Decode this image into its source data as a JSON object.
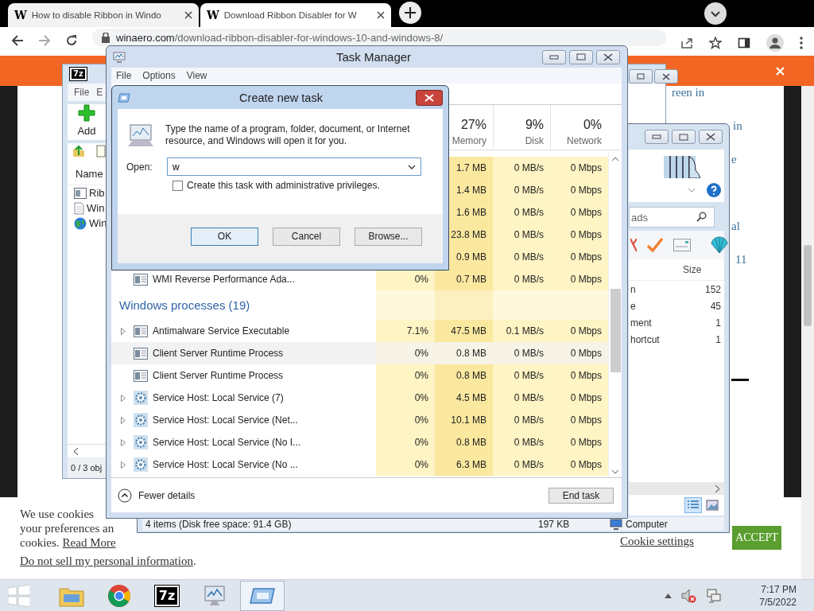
{
  "browser": {
    "tabs": [
      {
        "favicon": "W",
        "title": "How to disable Ribbon in Windo",
        "selected": false
      },
      {
        "favicon": "W",
        "title": "Download Ribbon Disabler for W",
        "selected": true
      }
    ],
    "url_host": "winaero.com",
    "url_path": "/download-ribbon-disabler-for-windows-10-and-windows-8/"
  },
  "page": {
    "fragments": [
      "reen in",
      "in",
      "e",
      "al",
      "11"
    ],
    "cookie": {
      "lines": [
        "We use cookies",
        "your preferences an"
      ],
      "last_line": "cookies.",
      "read_more": "Read More",
      "do_not_sell": "Do not sell my personal information",
      "after": ".",
      "settings": "Cookie settings",
      "accept": "ACCEPT"
    }
  },
  "seven_zip": {
    "logo": "7z",
    "menu": [
      "File",
      "E"
    ],
    "add_label": "Add",
    "column": "Name",
    "rows": [
      {
        "name": "Rib",
        "kind": "exe"
      },
      {
        "name": "Win",
        "kind": "doc"
      },
      {
        "name": "Win",
        "kind": "web"
      }
    ],
    "status": "0 / 3 obj"
  },
  "explorer": {
    "search_placeholder": "ads",
    "column": "Size",
    "rows": [
      {
        "name": "n",
        "size": "152"
      },
      {
        "name": "e",
        "size": "45"
      },
      {
        "name": "ment",
        "size": "1"
      },
      {
        "name": "hortcut",
        "size": "1"
      }
    ],
    "status": {
      "items": "4 items (Disk free space: 91.4 GB)",
      "size": "197 KB",
      "location": "Computer"
    }
  },
  "task_manager": {
    "title": "Task Manager",
    "menu": [
      "File",
      "Options",
      "View"
    ],
    "columns": [
      {
        "percent": "27%",
        "label": "Memory"
      },
      {
        "percent": "9%",
        "label": "Disk"
      },
      {
        "percent": "0%",
        "label": "Network"
      }
    ],
    "rows": [
      {
        "kind": "process",
        "memory": "1.7 MB",
        "disk": "0 MB/s",
        "network": "0 Mbps",
        "selected": false
      },
      {
        "kind": "process",
        "memory": "1.4 MB",
        "disk": "0 MB/s",
        "network": "0 Mbps",
        "selected": false
      },
      {
        "kind": "process",
        "memory": "1.6 MB",
        "disk": "0 MB/s",
        "network": "0 Mbps",
        "selected": false
      },
      {
        "kind": "process",
        "memory": "23.8 MB",
        "disk": "0 MB/s",
        "network": "0 Mbps",
        "selected": false
      },
      {
        "kind": "process",
        "memory": "0.9 MB",
        "disk": "0 MB/s",
        "network": "0 Mbps",
        "selected": false
      },
      {
        "kind": "app",
        "name": "WMI Reverse Performance Ada...",
        "expandable": false,
        "cpu": "0%",
        "memory": "0.7 MB",
        "disk": "0 MB/s",
        "network": "0 Mbps",
        "selected": false
      },
      {
        "kind": "group",
        "label": "Windows processes (19)"
      },
      {
        "kind": "app",
        "name": "Antimalware Service Executable",
        "expandable": true,
        "cpu": "7.1%",
        "memory": "47.5 MB",
        "disk": "0.1 MB/s",
        "network": "0 Mbps",
        "selected": false
      },
      {
        "kind": "app",
        "name": "Client Server Runtime Process",
        "expandable": false,
        "cpu": "0%",
        "memory": "0.8 MB",
        "disk": "0 MB/s",
        "network": "0 Mbps",
        "selected": true
      },
      {
        "kind": "app",
        "name": "Client Server Runtime Process",
        "expandable": false,
        "cpu": "0%",
        "memory": "0.8 MB",
        "disk": "0 MB/s",
        "network": "0 Mbps",
        "selected": false
      },
      {
        "kind": "service",
        "name": "Service Host: Local Service (7)",
        "expandable": true,
        "cpu": "0%",
        "memory": "4.5 MB",
        "disk": "0 MB/s",
        "network": "0 Mbps",
        "selected": false
      },
      {
        "kind": "service",
        "name": "Service Host: Local Service (Net...",
        "expandable": true,
        "cpu": "0%",
        "memory": "10.1 MB",
        "disk": "0 MB/s",
        "network": "0 Mbps",
        "selected": false
      },
      {
        "kind": "service",
        "name": "Service Host: Local Service (No I...",
        "expandable": true,
        "cpu": "0%",
        "memory": "0.8 MB",
        "disk": "0 MB/s",
        "network": "0 Mbps",
        "selected": false
      },
      {
        "kind": "service",
        "name": "Service Host: Local Service (No ...",
        "expandable": true,
        "cpu": "0%",
        "memory": "6.3 MB",
        "disk": "0 MB/s",
        "network": "0 Mbps",
        "selected": false
      }
    ],
    "fewer_details": "Fewer details",
    "end_task": "End task"
  },
  "dialog": {
    "title": "Create new task",
    "message": "Type the name of a program, folder, document, or Internet resource, and Windows will open it for you.",
    "open_label": "Open:",
    "value": "w",
    "admin": {
      "label": "Create this task with administrative privileges.",
      "checked": false
    },
    "buttons": [
      {
        "label": "OK",
        "default": true
      },
      {
        "label": "Cancel",
        "default": false
      },
      {
        "label": "Browse...",
        "default": false
      }
    ]
  },
  "taskbar": {
    "apps": [
      {
        "kind": "explorer",
        "selected": false
      },
      {
        "kind": "chrome",
        "selected": false
      },
      {
        "kind": "sevenzip",
        "label": "7z",
        "selected": false
      },
      {
        "kind": "taskmgr",
        "selected": false
      },
      {
        "kind": "dialog",
        "selected": true
      }
    ],
    "time": "7:17 PM",
    "date": "7/5/2022"
  }
}
